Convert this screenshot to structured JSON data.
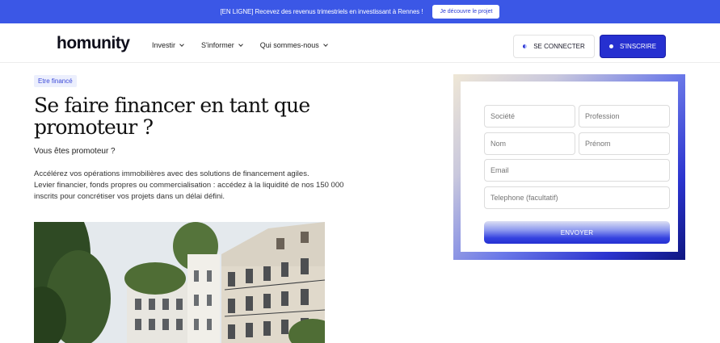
{
  "banner": {
    "text": "[EN LIGNE] Recevez des revenus trimestriels en investissant à Rennes !",
    "cta": "Je découvre le projet"
  },
  "header": {
    "logo": "homunity",
    "nav": [
      {
        "label": "Investir"
      },
      {
        "label": "S'informer"
      },
      {
        "label": "Qui sommes-nous"
      }
    ],
    "login": "SE CONNECTER",
    "signup": "S'INSCRIRE"
  },
  "main": {
    "tag": "Etre financé",
    "title": "Se faire financer en tant que promoteur ?",
    "subtitle": "Vous êtes promoteur ?",
    "description_lines": [
      "Accélérez vos opérations immobilières avec des solutions de financement agiles.",
      "Levier financier, fonds propres ou commercialisation : accédez à la liquidité de nos 150 000",
      "inscrits pour concrétiser vos projets dans un délai défini."
    ]
  },
  "form": {
    "company_placeholder": "Société",
    "profession_placeholder": "Profession",
    "lastname_placeholder": "Nom",
    "firstname_placeholder": "Prénom",
    "email_placeholder": "Email",
    "phone_placeholder": "Telephone (facultatif)",
    "submit": "ENVOYER"
  },
  "colors": {
    "brand": "#2630d0",
    "banner": "#3b57e6"
  }
}
